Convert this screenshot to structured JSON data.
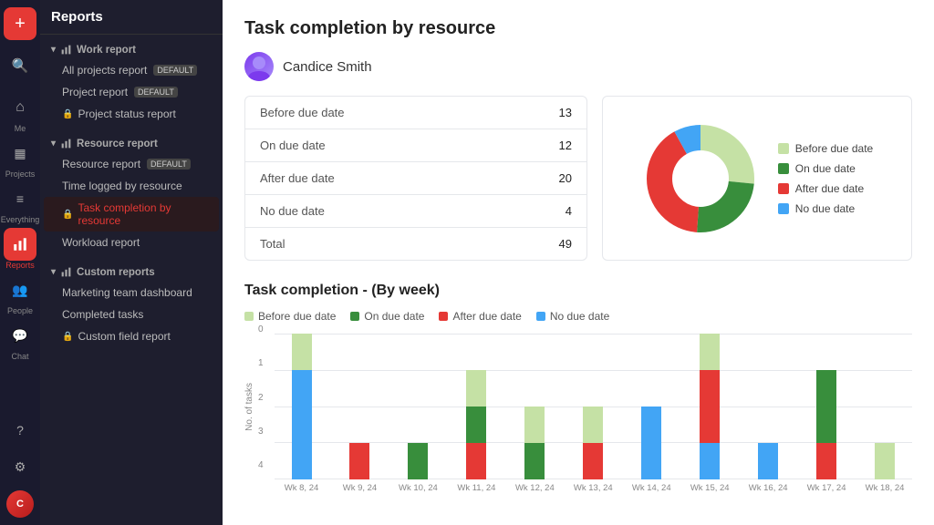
{
  "nav": {
    "title": "Reports",
    "sections": [
      {
        "id": "work_report",
        "icon": "📊",
        "label": "Work report",
        "items": [
          {
            "id": "all_projects",
            "label": "All projects report",
            "badge": "DEFAULT",
            "lock": false,
            "active": false
          },
          {
            "id": "project_report",
            "label": "Project report",
            "badge": "DEFAULT",
            "lock": false,
            "active": false
          },
          {
            "id": "project_status",
            "label": "Project status report",
            "badge": "",
            "lock": true,
            "active": false
          }
        ]
      },
      {
        "id": "resource_report",
        "icon": "📊",
        "label": "Resource report",
        "items": [
          {
            "id": "resource_report_item",
            "label": "Resource report",
            "badge": "DEFAULT",
            "lock": false,
            "active": false
          },
          {
            "id": "time_logged",
            "label": "Time logged by resource",
            "badge": "",
            "lock": false,
            "active": false
          },
          {
            "id": "task_completion",
            "label": "Task completion by resource",
            "badge": "",
            "lock": false,
            "active": true
          },
          {
            "id": "workload",
            "label": "Workload report",
            "badge": "",
            "lock": false,
            "active": false
          }
        ]
      },
      {
        "id": "custom_reports",
        "icon": "📊",
        "label": "Custom reports",
        "items": [
          {
            "id": "marketing_dashboard",
            "label": "Marketing team dashboard",
            "badge": "",
            "lock": false,
            "active": false
          },
          {
            "id": "completed_tasks",
            "label": "Completed tasks",
            "badge": "",
            "lock": false,
            "active": false
          },
          {
            "id": "custom_field",
            "label": "Custom field report",
            "badge": "",
            "lock": true,
            "active": false
          }
        ]
      }
    ]
  },
  "rail": {
    "items": [
      {
        "id": "add",
        "icon": "+",
        "label": "",
        "active": false
      },
      {
        "id": "search",
        "icon": "🔍",
        "label": "",
        "active": false
      },
      {
        "id": "home",
        "icon": "⌂",
        "label": "Me",
        "active": false
      },
      {
        "id": "projects",
        "icon": "▦",
        "label": "Projects",
        "active": false
      },
      {
        "id": "everything",
        "icon": "≡",
        "label": "Everything",
        "active": false
      },
      {
        "id": "reports",
        "icon": "📊",
        "label": "Reports",
        "active": true
      },
      {
        "id": "people",
        "icon": "👥",
        "label": "People",
        "active": false
      },
      {
        "id": "chat",
        "icon": "💬",
        "label": "Chat",
        "active": false
      }
    ]
  },
  "main": {
    "page_title": "Task completion by resource",
    "resource_name": "Candice Smith",
    "stats": [
      {
        "label": "Before due date",
        "value": "13"
      },
      {
        "label": "On due date",
        "value": "12"
      },
      {
        "label": "After due date",
        "value": "20"
      },
      {
        "label": "No due date",
        "value": "4"
      },
      {
        "label": "Total",
        "value": "49"
      }
    ],
    "donut": {
      "segments": [
        {
          "label": "Before due date",
          "color": "#c5e1a5",
          "value": 13,
          "percent": 26.5
        },
        {
          "label": "On due date",
          "color": "#388e3c",
          "value": 12,
          "percent": 24.5
        },
        {
          "label": "After due date",
          "color": "#e53935",
          "value": 20,
          "percent": 40.8
        },
        {
          "label": "No due date",
          "color": "#42a5f5",
          "value": 4,
          "percent": 8.2
        }
      ]
    },
    "bar_chart": {
      "title": "Task completion - (By week)",
      "y_label": "No. of tasks",
      "y_max": 4,
      "legend": [
        {
          "label": "Before due date",
          "color": "#c5e1a5"
        },
        {
          "label": "On due date",
          "color": "#388e3c"
        },
        {
          "label": "After due date",
          "color": "#e53935"
        },
        {
          "label": "No due date",
          "color": "#42a5f5"
        }
      ],
      "weeks": [
        {
          "label": "Wk 8, 24",
          "before": 1,
          "on": 0,
          "after": 0,
          "nodue": 3
        },
        {
          "label": "Wk 9, 24",
          "before": 0,
          "on": 0,
          "after": 1,
          "nodue": 0
        },
        {
          "label": "Wk 10, 24",
          "before": 0,
          "on": 1,
          "after": 0,
          "nodue": 0
        },
        {
          "label": "Wk 11, 24",
          "before": 1,
          "on": 1,
          "after": 1,
          "nodue": 0
        },
        {
          "label": "Wk 12, 24",
          "before": 1,
          "on": 1,
          "after": 0,
          "nodue": 0
        },
        {
          "label": "Wk 13, 24",
          "before": 1,
          "on": 0,
          "after": 1,
          "nodue": 0
        },
        {
          "label": "Wk 14, 24",
          "before": 0,
          "on": 0,
          "after": 0,
          "nodue": 2
        },
        {
          "label": "Wk 15, 24",
          "before": 1,
          "on": 0,
          "after": 2,
          "nodue": 1
        },
        {
          "label": "Wk 16, 24",
          "before": 0,
          "on": 0,
          "after": 0,
          "nodue": 1
        },
        {
          "label": "Wk 17, 24",
          "before": 0,
          "on": 2,
          "after": 1,
          "nodue": 0
        },
        {
          "label": "Wk 18, 24",
          "before": 1,
          "on": 0,
          "after": 0,
          "nodue": 0
        }
      ]
    }
  },
  "colors": {
    "sidebar_bg": "#1e1e2e",
    "rail_bg": "#1a1a2e",
    "accent": "#e53935",
    "before_due": "#c5e1a5",
    "on_due": "#388e3c",
    "after_due": "#e53935",
    "no_due": "#42a5f5"
  }
}
